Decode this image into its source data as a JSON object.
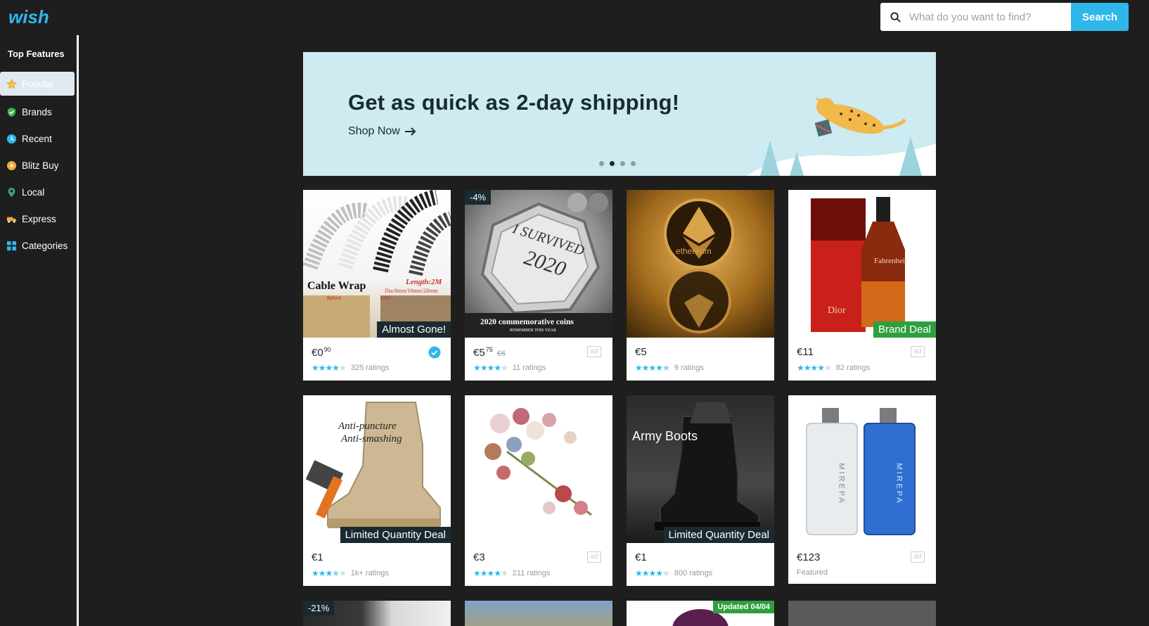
{
  "header": {
    "logo_text": "wish",
    "search_placeholder": "What do you want to find?",
    "search_button": "Search"
  },
  "sidebar": {
    "title": "Top Features",
    "items": [
      {
        "label": "Popular",
        "icon": "star-icon"
      },
      {
        "label": "Brands",
        "icon": "shield-check-icon"
      },
      {
        "label": "Recent",
        "icon": "clock-icon"
      },
      {
        "label": "Blitz Buy",
        "icon": "lightning-coin-icon"
      },
      {
        "label": "Local",
        "icon": "location-pin-icon"
      },
      {
        "label": "Express",
        "icon": "truck-icon"
      },
      {
        "label": "Categories",
        "icon": "grid-icon"
      }
    ]
  },
  "banner": {
    "headline": "Get as quick as 2-day shipping!",
    "cta": "Shop Now",
    "slide_count": 4,
    "active_slide": 2
  },
  "products": [
    {
      "price": "€0",
      "cents": "90",
      "rating_text": "325 ratings",
      "stars": 4,
      "badge": "Almost Gone!",
      "overlay": "Cable Wrap",
      "overlay2": "Length:2M",
      "overlay3": "Dia:8mm/10mm/28mm",
      "overlay4": "Before",
      "overlay5": "After",
      "verified": true
    },
    {
      "price": "€5",
      "cents": "75",
      "old_price": "€6",
      "rating_text": "11 ratings",
      "stars": 4,
      "discount": "-4%",
      "overlay": "2020 commemorative coins",
      "overlay2": "REMEMBER THIS YEAR",
      "coin_text1": "I SURVIVED",
      "coin_text2": "2020",
      "ad": "ad"
    },
    {
      "price": "€5",
      "rating_text": "9 ratings",
      "stars": 4.5,
      "overlay": "ethereum"
    },
    {
      "price": "€11",
      "rating_text": "82 ratings",
      "stars": 4,
      "badge": "Brand Deal",
      "overlay": "Fahrenheit",
      "overlay2": "Dior",
      "ad": "ad"
    },
    {
      "price": "€1",
      "rating_text": "1k+ ratings",
      "stars": 3.5,
      "badge": "Limited Quantity Deal",
      "overlay": "Anti-puncture",
      "overlay2": "Anti-smashing"
    },
    {
      "price": "€3",
      "rating_text": "211 ratings",
      "stars": 4,
      "ad": "ad"
    },
    {
      "price": "€1",
      "rating_text": "800 ratings",
      "stars": 4,
      "badge": "Limited Quantity Deal",
      "overlay": "Army Boots"
    },
    {
      "price": "€123",
      "featured": "Featured",
      "overlay": "MIREPA",
      "ad": "ad"
    },
    {
      "discount": "-21%"
    },
    {},
    {
      "updated": "Updated 04/04"
    },
    {}
  ],
  "colors": {
    "brand_blue": "#2fb7ec",
    "dark": "#192a32",
    "deal_green": "#2e9f3e",
    "page_bg": "#1e1e1e",
    "banner_bg": "#cdebf1"
  }
}
